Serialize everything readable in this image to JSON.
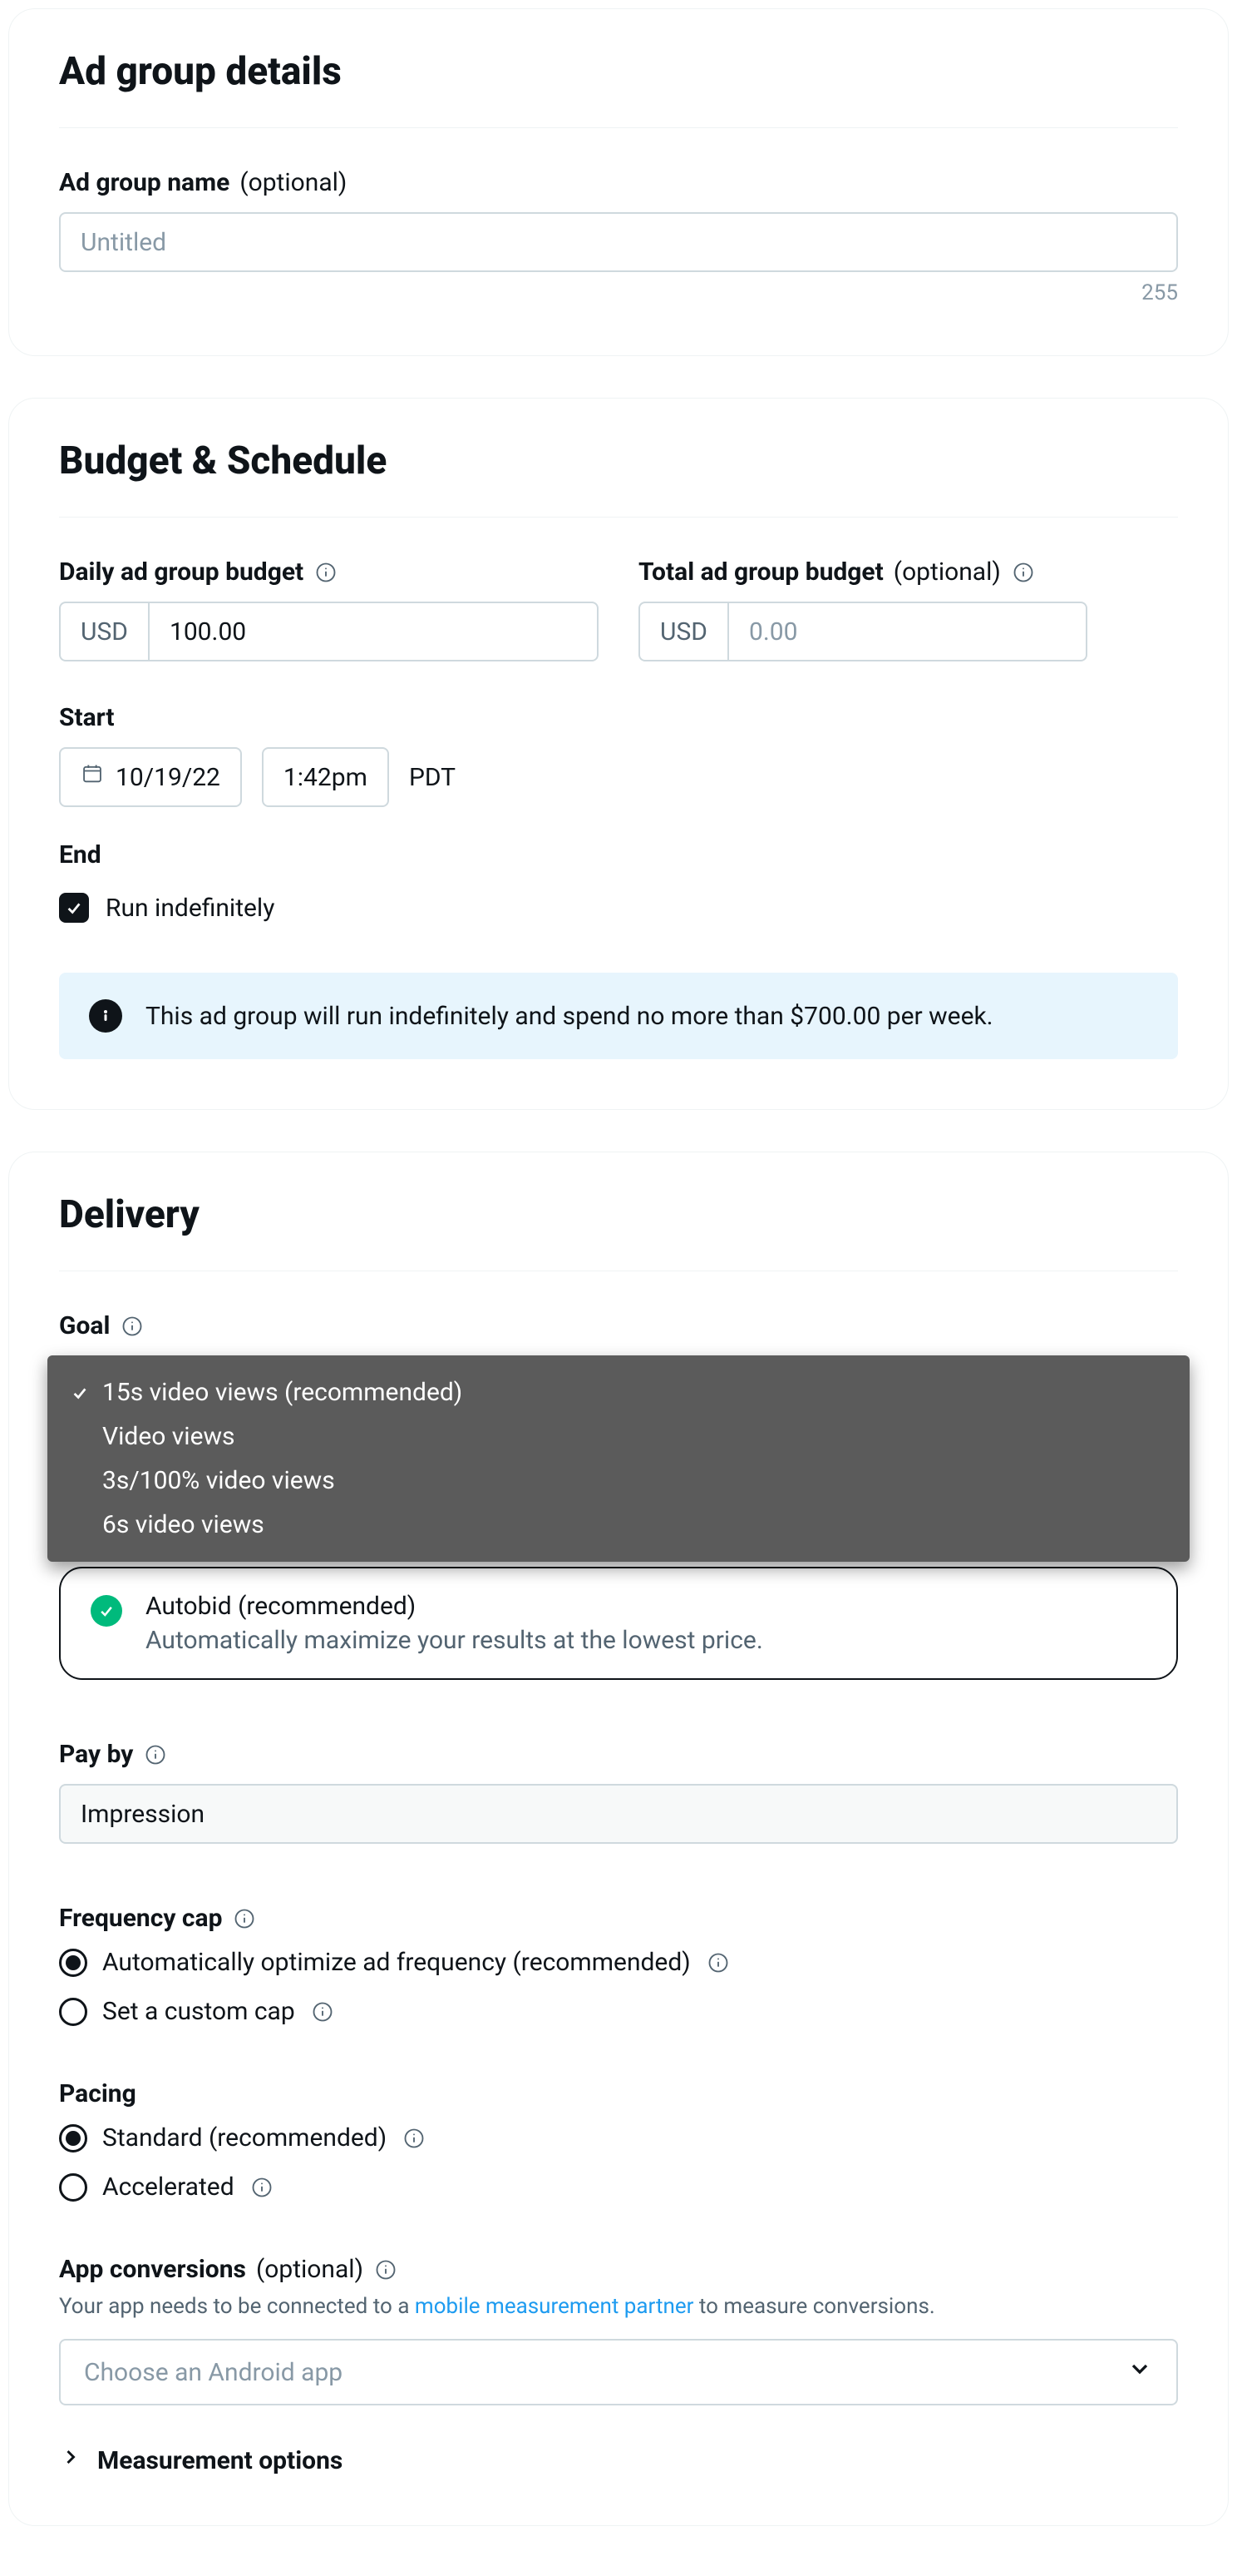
{
  "ad_group_details": {
    "title": "Ad group details",
    "name_label": "Ad group name",
    "name_optional": "(optional)",
    "name_placeholder": "Untitled",
    "char_count": "255"
  },
  "budget": {
    "title": "Budget & Schedule",
    "daily_label": "Daily ad group budget",
    "daily_currency": "USD",
    "daily_value": "100.00",
    "total_label": "Total ad group budget",
    "total_optional": "(optional)",
    "total_currency": "USD",
    "total_placeholder": "0.00",
    "start_label": "Start",
    "start_date": "10/19/22",
    "start_time": "1:42pm",
    "timezone": "PDT",
    "end_label": "End",
    "run_indef": "Run indefinitely",
    "banner": "This ad group will run indefinitely and spend no more than $700.00 per week."
  },
  "delivery": {
    "title": "Delivery",
    "goal_label": "Goal",
    "goal_options": {
      "o1": "15s video views (recommended)",
      "o2": "Video views",
      "o3": "3s/100% video views",
      "o4": "6s video views"
    },
    "autobid_title": "Autobid (recommended)",
    "autobid_desc": "Automatically maximize your results at the lowest price.",
    "payby_label": "Pay by",
    "payby_value": "Impression",
    "freq_label": "Frequency cap",
    "freq_auto": "Automatically optimize ad frequency (recommended)",
    "freq_custom": "Set a custom cap",
    "pacing_label": "Pacing",
    "pacing_standard": "Standard (recommended)",
    "pacing_accel": "Accelerated",
    "app_label": "App conversions",
    "app_optional": "(optional)",
    "app_helper_pre": "Your app needs to be connected to a ",
    "app_helper_link": "mobile measurement partner",
    "app_helper_post": " to measure conversions.",
    "app_placeholder": "Choose an Android app",
    "measurement": "Measurement options"
  }
}
